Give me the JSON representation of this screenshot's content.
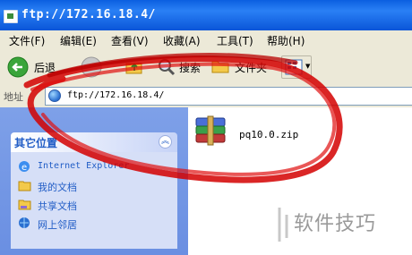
{
  "window": {
    "title": "ftp://172.16.18.4/"
  },
  "menu": [
    "文件(F)",
    "编辑(E)",
    "查看(V)",
    "收藏(A)",
    "工具(T)",
    "帮助(H)"
  ],
  "toolbar": {
    "back_label": "后退",
    "search_label": "搜索",
    "folders_label": "文件夹"
  },
  "address": {
    "label": "地址",
    "value": "ftp://172.16.18.4/"
  },
  "sidebar": {
    "panel_title": "其它位置",
    "links": [
      {
        "label": "Internet Explorer",
        "icon": "ie-icon"
      },
      {
        "label": "我的文档",
        "icon": "my-documents-icon"
      },
      {
        "label": "共享文档",
        "icon": "shared-documents-icon"
      },
      {
        "label": "网上邻居",
        "icon": "network-places-icon"
      }
    ]
  },
  "files": [
    {
      "name": "pq10.0.zip",
      "icon": "winrar-archive-icon"
    }
  ],
  "watermark": {
    "text": "软件技巧"
  },
  "colors": {
    "titlebar": "#0b5fe0",
    "sidebar": "#6a8fe2",
    "link": "#215dc6",
    "scribble": "#d40000"
  }
}
